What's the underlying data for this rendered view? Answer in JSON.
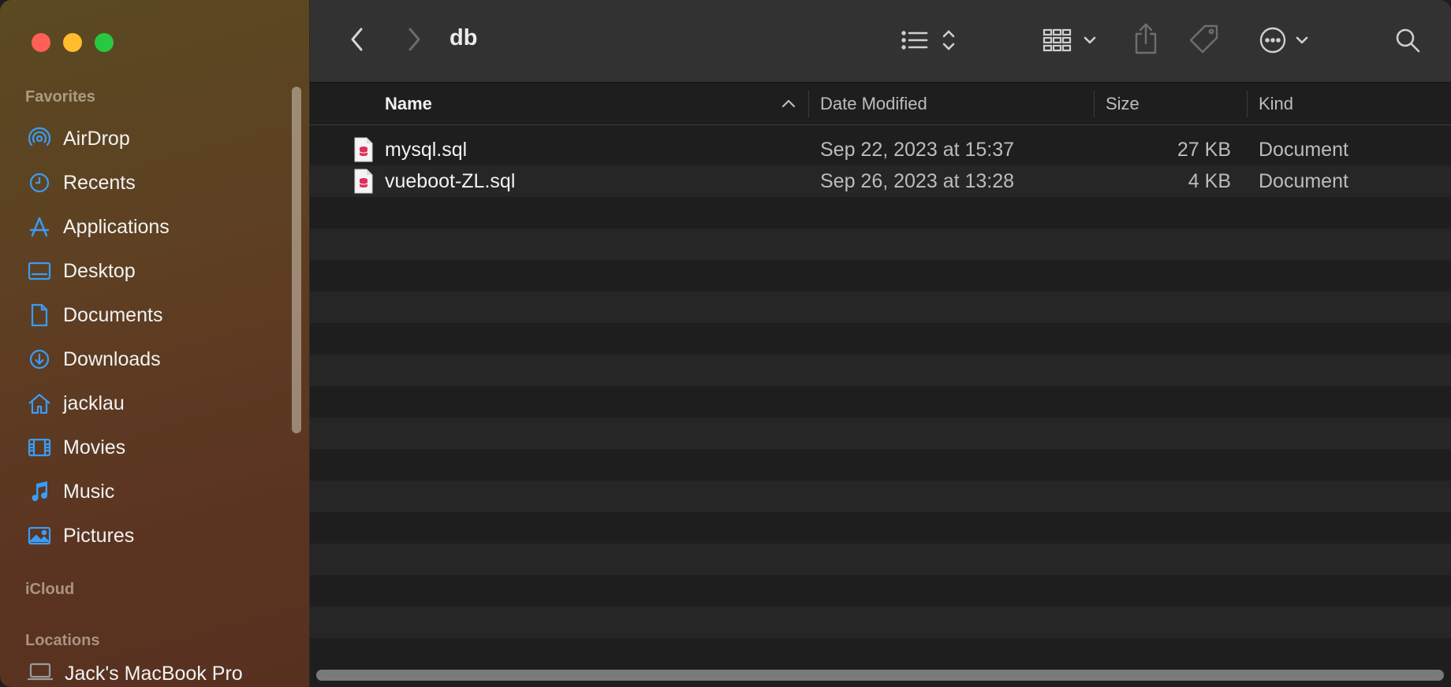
{
  "window": {
    "title": "db"
  },
  "sidebar": {
    "favorites_label": "Favorites",
    "items": [
      {
        "label": "AirDrop",
        "icon": "airdrop-icon"
      },
      {
        "label": "Recents",
        "icon": "clock-icon"
      },
      {
        "label": "Applications",
        "icon": "applications-icon"
      },
      {
        "label": "Desktop",
        "icon": "desktop-icon"
      },
      {
        "label": "Documents",
        "icon": "document-icon"
      },
      {
        "label": "Downloads",
        "icon": "download-icon"
      },
      {
        "label": "jacklau",
        "icon": "home-icon"
      },
      {
        "label": "Movies",
        "icon": "film-icon"
      },
      {
        "label": "Music",
        "icon": "music-note-icon"
      },
      {
        "label": "Pictures",
        "icon": "photo-icon"
      }
    ],
    "icloud_label": "iCloud",
    "locations_label": "Locations",
    "location_item": "Jack's MacBook Pro"
  },
  "columns": {
    "name": "Name",
    "date": "Date Modified",
    "size": "Size",
    "kind": "Kind"
  },
  "files": [
    {
      "name": "mysql.sql",
      "date": "Sep 22, 2023 at 15:37",
      "size": "27 KB",
      "kind": "Document"
    },
    {
      "name": "vueboot-ZL.sql",
      "date": "Sep 26, 2023 at 13:28",
      "size": "4 KB",
      "kind": "Document"
    }
  ],
  "colors": {
    "accent": "#3b9cf5",
    "sql_icon": "#e0305a"
  }
}
